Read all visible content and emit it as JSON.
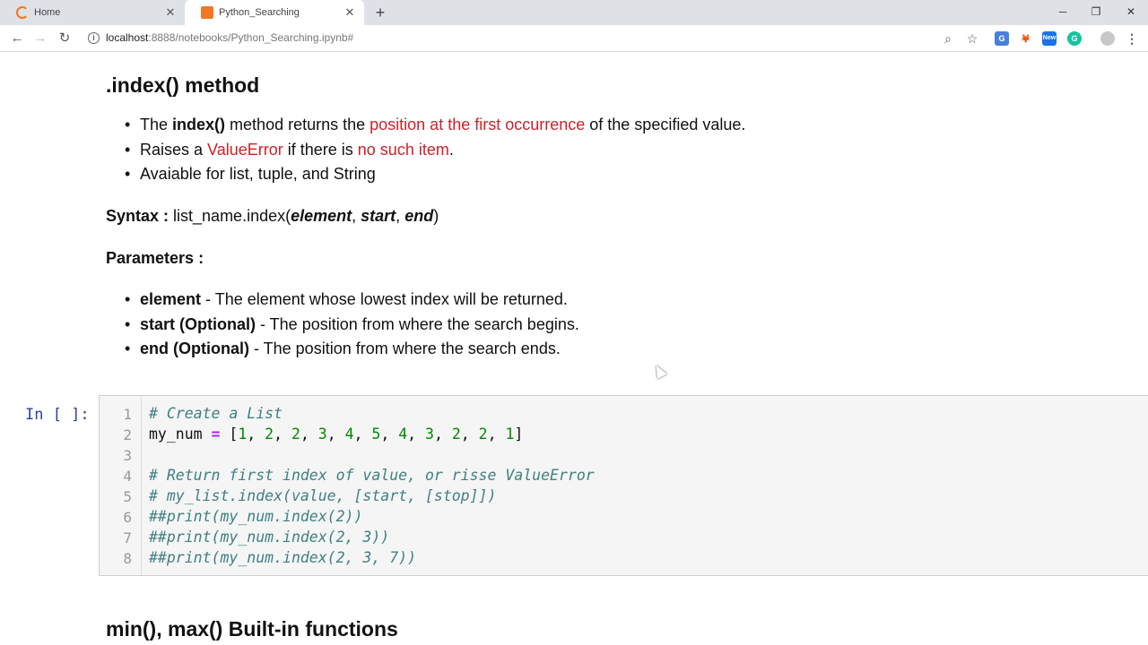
{
  "browser": {
    "tabs": [
      {
        "title": "Home",
        "active": false
      },
      {
        "title": "Python_Searching",
        "active": true
      }
    ],
    "url_host": "localhost",
    "url_path": ":8888/notebooks/Python_Searching.ipynb#",
    "extensions": [
      "translate-icon",
      "metamask-icon",
      "new-icon",
      "grammarly-icon"
    ]
  },
  "notebook": {
    "heading": ".index() method",
    "bullets": [
      {
        "a": "The ",
        "b": "index()",
        "c": " method returns the ",
        "red": "position at the first occurrence",
        "d": " of the specified value."
      },
      {
        "a": "Raises a ",
        "red1": "ValueError",
        "b": " if there is ",
        "red2": "no such item",
        "c": "."
      },
      {
        "a": "Avaiable for list, tuple, and String"
      }
    ],
    "syntax": {
      "label": "Syntax :",
      "pre": " list_name.index(",
      "arg1": "element",
      "sep1": ", ",
      "arg2": "start",
      "sep2": ", ",
      "arg3": "end",
      "post": ")"
    },
    "params_label": "Parameters :",
    "params": [
      {
        "name": "element",
        "desc": " - The element whose lowest index will be returned."
      },
      {
        "name": "start (Optional)",
        "desc": " - The position from where the search begins."
      },
      {
        "name": "end (Optional)",
        "desc": " - The position from where the search ends."
      }
    ],
    "cell_prompt": "In [ ]:",
    "code_lines": [
      "# Create a List",
      "my_num = [1, 2, 2, 3, 4, 5, 4, 3, 2, 2, 1]",
      "",
      "# Return first index of value, or risse ValueError",
      "# my_list.index(value, [start, [stop]])",
      "##print(my_num.index(2))",
      "##print(my_num.index(2, 3))",
      "##print(my_num.index(2, 3, 7))"
    ],
    "line_numbers": [
      "1",
      "2",
      "3",
      "4",
      "5",
      "6",
      "7",
      "8"
    ],
    "next_heading": "min(), max() Built-in functions"
  }
}
